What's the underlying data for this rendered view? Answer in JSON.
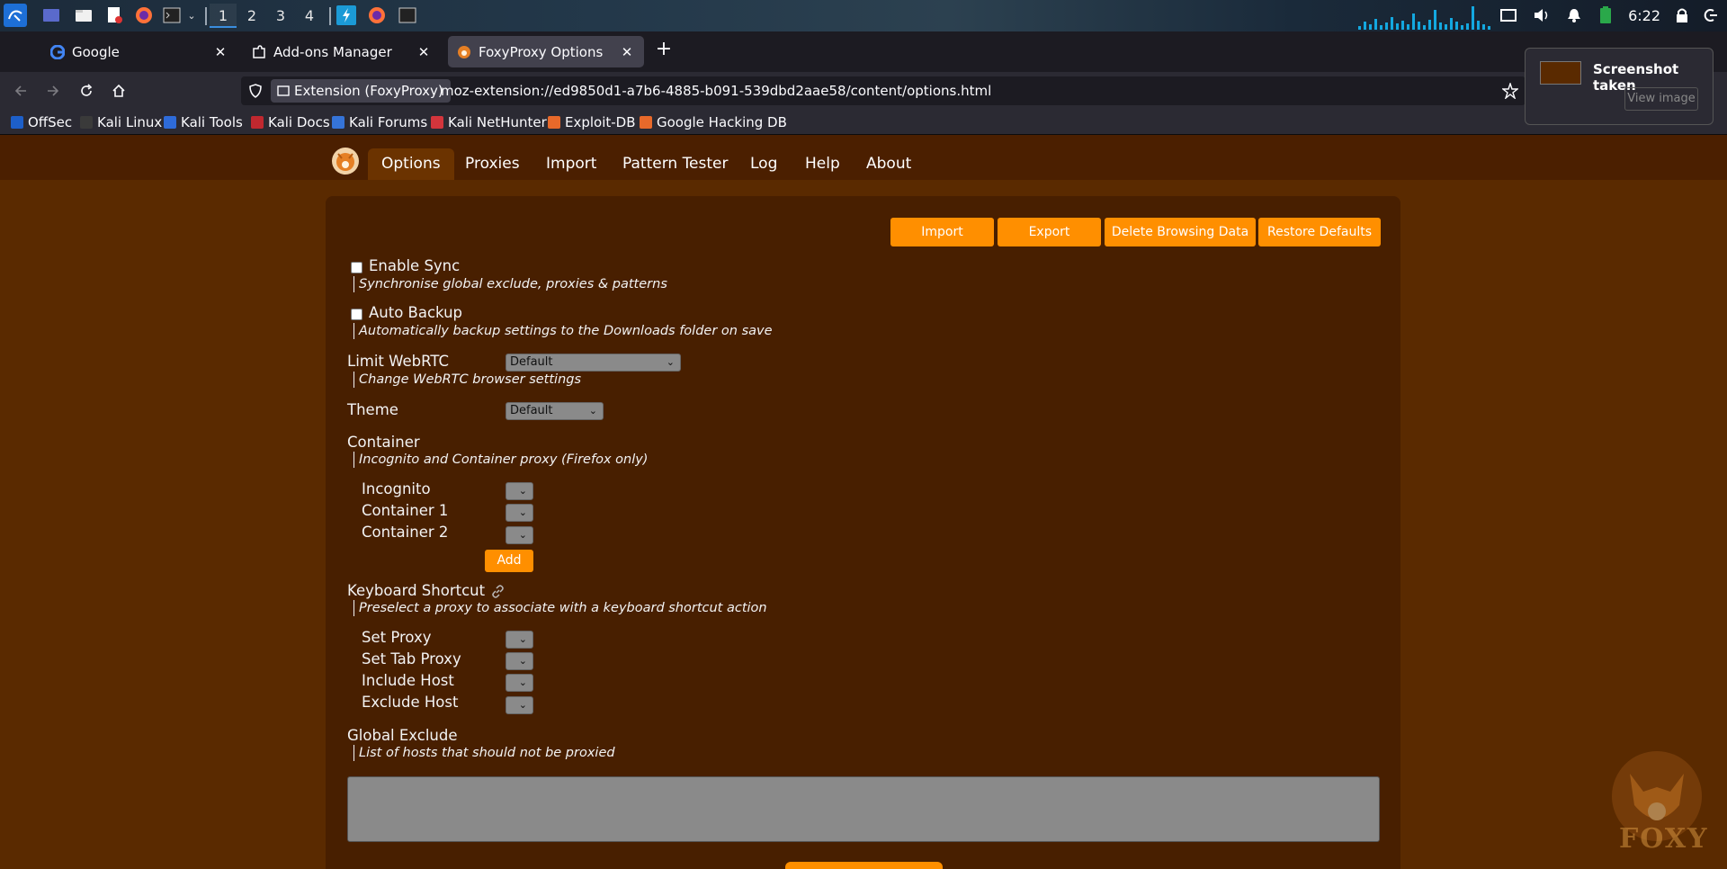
{
  "taskbar": {
    "workspaces": [
      "1",
      "2",
      "3",
      "4"
    ],
    "active_workspace": "1",
    "clock": "6:22"
  },
  "browser": {
    "tabs": [
      {
        "label": "Google",
        "icon": "google-icon"
      },
      {
        "label": "Add-ons Manager",
        "icon": "puzzle-icon"
      },
      {
        "label": "FoxyProxy Options",
        "icon": "foxyproxy-icon",
        "active": true
      }
    ],
    "identity_label": "Extension (FoxyProxy)",
    "url": "moz-extension://ed9850d1-a7b6-4885-b091-539dbd2aae58/content/options.html",
    "bookmarks": [
      "OffSec",
      "Kali Linux",
      "Kali Tools",
      "Kali Docs",
      "Kali Forums",
      "Kali NetHunter",
      "Exploit-DB",
      "Google Hacking DB"
    ]
  },
  "notification": {
    "title": "Screenshot taken",
    "button": "View image"
  },
  "foxyproxy": {
    "nav": [
      "Options",
      "Proxies",
      "Import",
      "Pattern Tester",
      "Log",
      "Help",
      "About"
    ],
    "active_nav": "Options",
    "actions": {
      "import": "Import",
      "export": "Export",
      "delete": "Delete Browsing Data",
      "restore": "Restore Defaults"
    },
    "sync": {
      "label": "Enable Sync",
      "desc": "Synchronise global exclude, proxies & patterns",
      "checked": false
    },
    "backup": {
      "label": "Auto Backup",
      "desc": "Automatically backup settings to the Downloads folder on save",
      "checked": false
    },
    "webrtc": {
      "label": "Limit WebRTC",
      "desc": "Change WebRTC browser settings",
      "value": "Default"
    },
    "theme": {
      "label": "Theme",
      "value": "Default"
    },
    "container": {
      "label": "Container",
      "desc": "Incognito and Container proxy (Firefox only)",
      "items": [
        "Incognito",
        "Container 1",
        "Container 2"
      ],
      "add": "Add"
    },
    "shortcut": {
      "label": "Keyboard Shortcut",
      "desc": "Preselect a proxy to associate with a keyboard shortcut action",
      "items": [
        "Set Proxy",
        "Set Tab Proxy",
        "Include Host",
        "Exclude Host"
      ]
    },
    "exclude": {
      "label": "Global Exclude",
      "desc": "List of hosts that should not be proxied",
      "value": ""
    },
    "watermark": "FOXY"
  },
  "colors": {
    "accent": "#ff8f00",
    "page_bg": "#5a2a00",
    "panel_bg": "#481f00",
    "nav_bg": "#4b1f00"
  }
}
